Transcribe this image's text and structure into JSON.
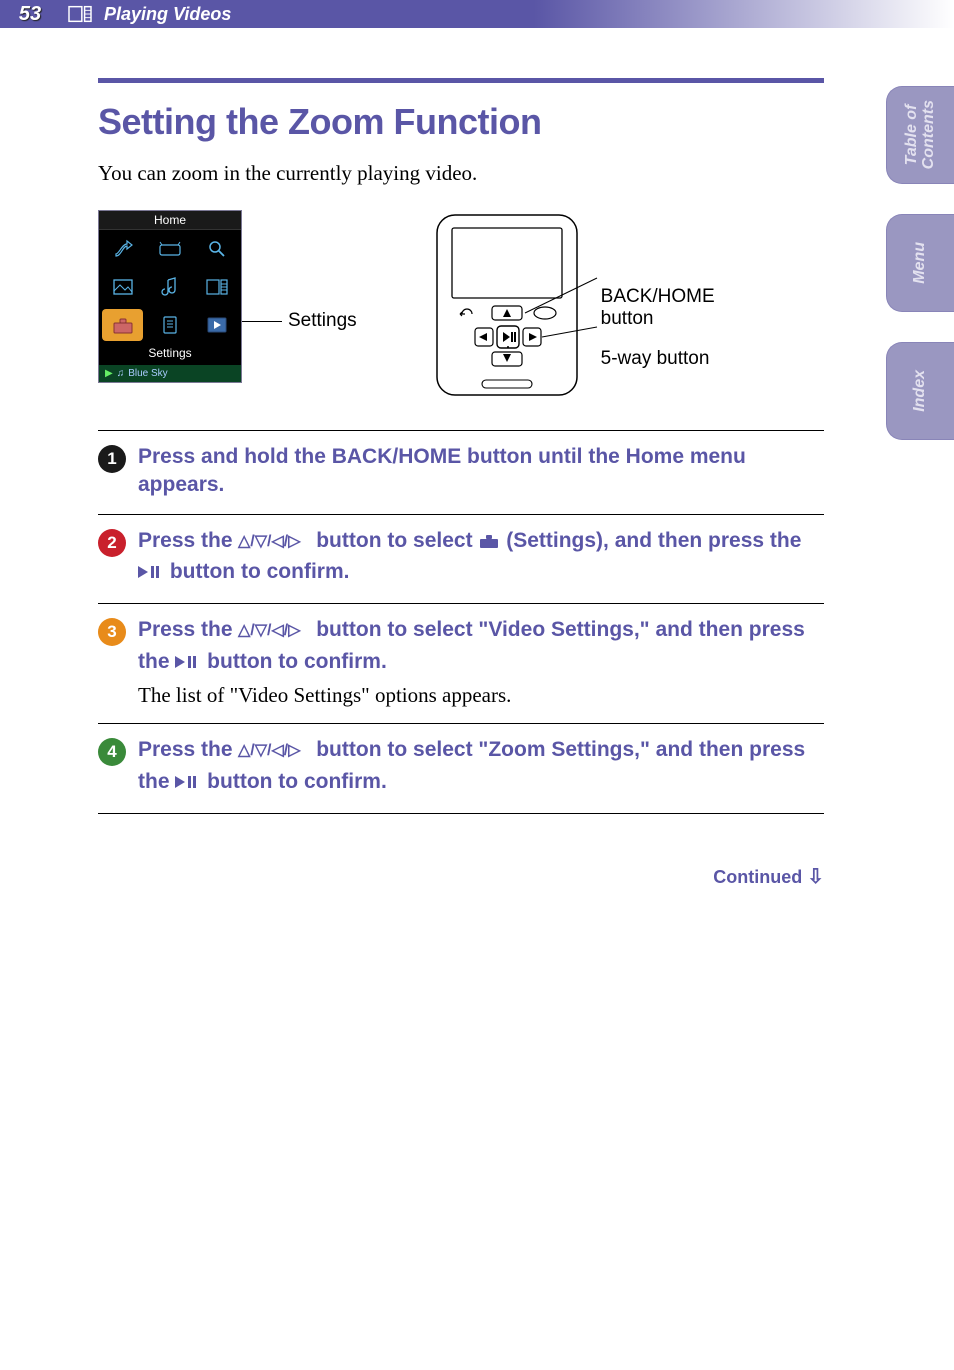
{
  "header": {
    "page_number": "53",
    "chapter": "Playing Videos"
  },
  "side_tabs": {
    "toc": "Table of\nContents",
    "menu": "Menu",
    "index": "Index"
  },
  "title": "Setting the Zoom Function",
  "intro": "You can zoom in the currently playing video.",
  "device_screen": {
    "top": "Home",
    "label": "Settings",
    "nowplaying_prefix": "♫",
    "nowplaying": "Blue Sky"
  },
  "callouts": {
    "settings": "Settings",
    "back_home": "BACK/HOME button",
    "five_way": "5-way button"
  },
  "steps": {
    "s1": "Press and hold the BACK/HOME button until the Home menu appears.",
    "s2a": "Press the ",
    "s2b": " button to select ",
    "s2c": " (Settings), and then press the ",
    "s2d": " button to confirm.",
    "s3a": "Press the ",
    "s3b": " button to select \"Video Settings,\" and then press the ",
    "s3c": " button to confirm.",
    "s3plain": "The list of \"Video Settings\" options appears.",
    "s4a": "Press the ",
    "s4b": " button to select \"Zoom Settings,\" and then press the ",
    "s4c": " button to confirm."
  },
  "step_numbers": {
    "n1": "1",
    "n2": "2",
    "n3": "3",
    "n4": "4"
  },
  "continued": "Continued",
  "icons": {
    "nav_glyph": "△/▽/◁/▷",
    "play_glyph": "▷||"
  }
}
